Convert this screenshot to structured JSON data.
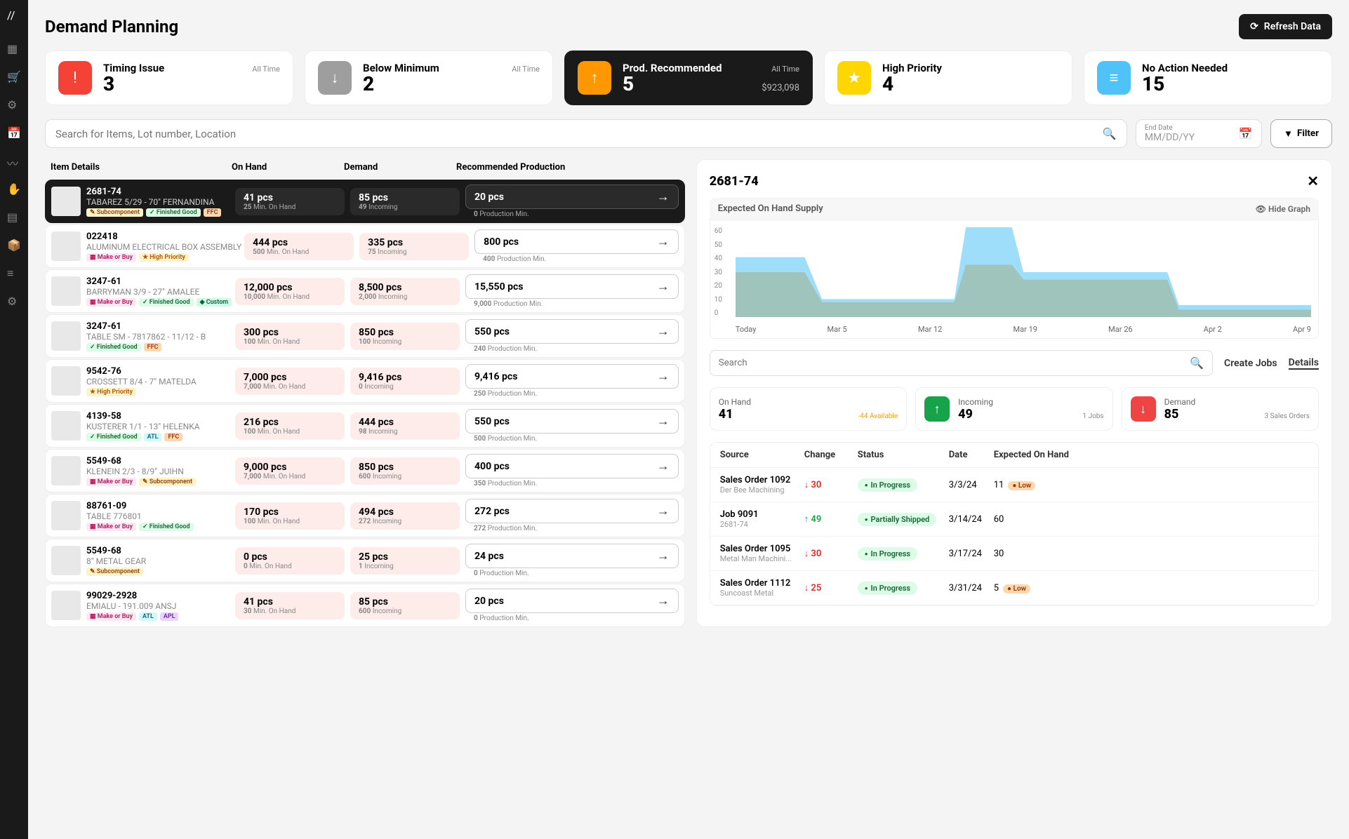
{
  "page_title": "Demand Planning",
  "refresh_button": "Refresh Data",
  "cards": [
    {
      "label": "Timing Issue",
      "value": "3",
      "sub": "All Time",
      "color": "#f44336",
      "icon": "!"
    },
    {
      "label": "Below Minimum",
      "value": "2",
      "sub": "All Time",
      "color": "#9e9e9e",
      "icon": "↓"
    },
    {
      "label": "Prod. Recommended",
      "value": "5",
      "sub": "All Time",
      "color": "#ff9800",
      "icon": "↑",
      "extra": "$923,098",
      "dark": true
    },
    {
      "label": "High Priority",
      "value": "4",
      "sub": "",
      "color": "#ffd600",
      "icon": "★"
    },
    {
      "label": "No Action Needed",
      "value": "15",
      "sub": "",
      "color": "#4fc3f7",
      "icon": "≡"
    }
  ],
  "search_placeholder": "Search for Items, Lot number, Location",
  "end_date_label": "End Date",
  "end_date_placeholder": "MM/DD/YY",
  "filter_button": "Filter",
  "table_headers": {
    "item": "Item Details",
    "onhand": "On Hand",
    "demand": "Demand",
    "rec": "Recommended Production"
  },
  "sub_labels": {
    "min_onhand": "Min. On Hand",
    "incoming": "Incoming",
    "prod_min": "Production Min."
  },
  "rows": [
    {
      "id": "2681-74",
      "name": "TABAREZ 5/29 - 70\" FERNANDINA",
      "tags": [
        "sub",
        "fin",
        "ffc"
      ],
      "onhand": "41 pcs",
      "onhand_sub": "25",
      "demand": "85 pcs",
      "demand_sub": "49",
      "rec": "20 pcs",
      "rec_sub": "0",
      "selected": true
    },
    {
      "id": "022418",
      "name": "ALUMINUM ELECTRICAL BOX ASSEMBLY",
      "tags": [
        "mob",
        "hp"
      ],
      "onhand": "444 pcs",
      "onhand_sub": "500",
      "demand": "335 pcs",
      "demand_sub": "75",
      "rec": "800 pcs",
      "rec_sub": "400"
    },
    {
      "id": "3247-61",
      "name": "BARRYMAN 3/9 - 27\" AMALEE",
      "tags": [
        "mob",
        "fin",
        "custom"
      ],
      "onhand": "12,000 pcs",
      "onhand_sub": "10,000",
      "demand": "8,500 pcs",
      "demand_sub": "2,000",
      "rec": "15,550 pcs",
      "rec_sub": "9,000"
    },
    {
      "id": "3247-61",
      "name": "TABLE SM - 7817862 - 11/12 - B",
      "tags": [
        "fin",
        "ffc"
      ],
      "onhand": "300 pcs",
      "onhand_sub": "100",
      "demand": "850 pcs",
      "demand_sub": "100",
      "rec": "550 pcs",
      "rec_sub": "240"
    },
    {
      "id": "9542-76",
      "name": "CROSSETT 8/4 - 7\" MATELDA",
      "tags": [
        "hp"
      ],
      "onhand": "7,000 pcs",
      "onhand_sub": "7,000",
      "demand": "9,416 pcs",
      "demand_sub": "0",
      "rec": "9,416 pcs",
      "rec_sub": "250"
    },
    {
      "id": "4139-58",
      "name": "KUSTERER 1/1 - 13\" HELENKA",
      "tags": [
        "fin",
        "atl",
        "ffc"
      ],
      "onhand": "216 pcs",
      "onhand_sub": "100",
      "demand": "444 pcs",
      "demand_sub": "98",
      "rec": "550 pcs",
      "rec_sub": "500"
    },
    {
      "id": "5549-68",
      "name": "KLENEIN 2/3 - 8/9\" JUIHN",
      "tags": [
        "mob",
        "sub"
      ],
      "onhand": "9,000 pcs",
      "onhand_sub": "7,000",
      "demand": "850 pcs",
      "demand_sub": "600",
      "rec": "400 pcs",
      "rec_sub": "350"
    },
    {
      "id": "88761-09",
      "name": "TABLE 776801",
      "tags": [
        "mob",
        "fin"
      ],
      "onhand": "170 pcs",
      "onhand_sub": "100",
      "demand": "494 pcs",
      "demand_sub": "272",
      "rec": "272 pcs",
      "rec_sub": "272"
    },
    {
      "id": "5549-68",
      "name": "8\" METAL GEAR",
      "tags": [
        "sub"
      ],
      "onhand": "0 pcs",
      "onhand_sub": "0",
      "demand": "25 pcs",
      "demand_sub": "1",
      "rec": "24 pcs",
      "rec_sub": "0"
    },
    {
      "id": "99029-2928",
      "name": "EMIALU - 191.009 ANSJ",
      "tags": [
        "mob",
        "atl",
        "apl"
      ],
      "onhand": "41 pcs",
      "onhand_sub": "30",
      "demand": "85 pcs",
      "demand_sub": "600",
      "rec": "20 pcs",
      "rec_sub": "0"
    }
  ],
  "tag_labels": {
    "sub": "Subcomponent",
    "fin": "Finished Good",
    "ffc": "FFC",
    "mob": "Make or Buy",
    "hp": "High Priority",
    "custom": "Custom",
    "atl": "ATL",
    "apl": "APL"
  },
  "detail": {
    "title": "2681-74",
    "graph_title": "Expected On Hand Supply",
    "hide_graph": "Hide Graph",
    "search_placeholder": "Search",
    "create_jobs": "Create Jobs",
    "details_tab": "Details",
    "stats": [
      {
        "label": "On Hand",
        "value": "41",
        "sub": "-44 Available",
        "subclass": "orange"
      },
      {
        "label": "Incoming",
        "value": "49",
        "sub": "1 Jobs",
        "icon": "↑",
        "color": "#16a34a"
      },
      {
        "label": "Demand",
        "value": "85",
        "sub": "3 Sales Orders",
        "icon": "↓",
        "color": "#ef4444"
      }
    ],
    "source_headers": {
      "source": "Source",
      "change": "Change",
      "status": "Status",
      "date": "Date",
      "exp": "Expected On Hand"
    },
    "sources": [
      {
        "name": "Sales Order 1092",
        "sub": "Der Bee Machining",
        "change": "30",
        "dir": "down",
        "status": "In Progress",
        "date": "3/3/24",
        "exp": "11",
        "warn": "Low"
      },
      {
        "name": "Job 9091",
        "sub": "2681-74",
        "change": "49",
        "dir": "up",
        "status": "Partially Shipped",
        "date": "3/14/24",
        "exp": "60"
      },
      {
        "name": "Sales Order 1095",
        "sub": "Metal Man Machini...",
        "change": "30",
        "dir": "down",
        "status": "In Progress",
        "date": "3/17/24",
        "exp": "30"
      },
      {
        "name": "Sales Order 1112",
        "sub": "Suncoast Metal",
        "change": "25",
        "dir": "down",
        "status": "In Progress",
        "date": "3/31/24",
        "exp": "5",
        "warn": "Low"
      }
    ]
  },
  "chart_data": {
    "type": "area",
    "x_labels": [
      "Today",
      "Mar 5",
      "Mar 12",
      "Mar 19",
      "Mar 26",
      "Apr 2",
      "Apr 9"
    ],
    "y_ticks": [
      0,
      10,
      20,
      30,
      40,
      50,
      60
    ],
    "ylim": [
      0,
      60
    ],
    "series": [
      {
        "name": "Expected",
        "color": "#4fc3f7",
        "values": [
          40,
          40,
          12,
          12,
          60,
          60,
          30,
          30,
          8,
          8
        ]
      },
      {
        "name": "On Hand",
        "color": "#ff9800",
        "values": [
          30,
          30,
          10,
          10,
          35,
          35,
          25,
          25,
          5,
          5
        ]
      }
    ],
    "x_positions": [
      0,
      0.12,
      0.15,
      0.38,
      0.4,
      0.48,
      0.5,
      0.75,
      0.77,
      1.0
    ]
  }
}
